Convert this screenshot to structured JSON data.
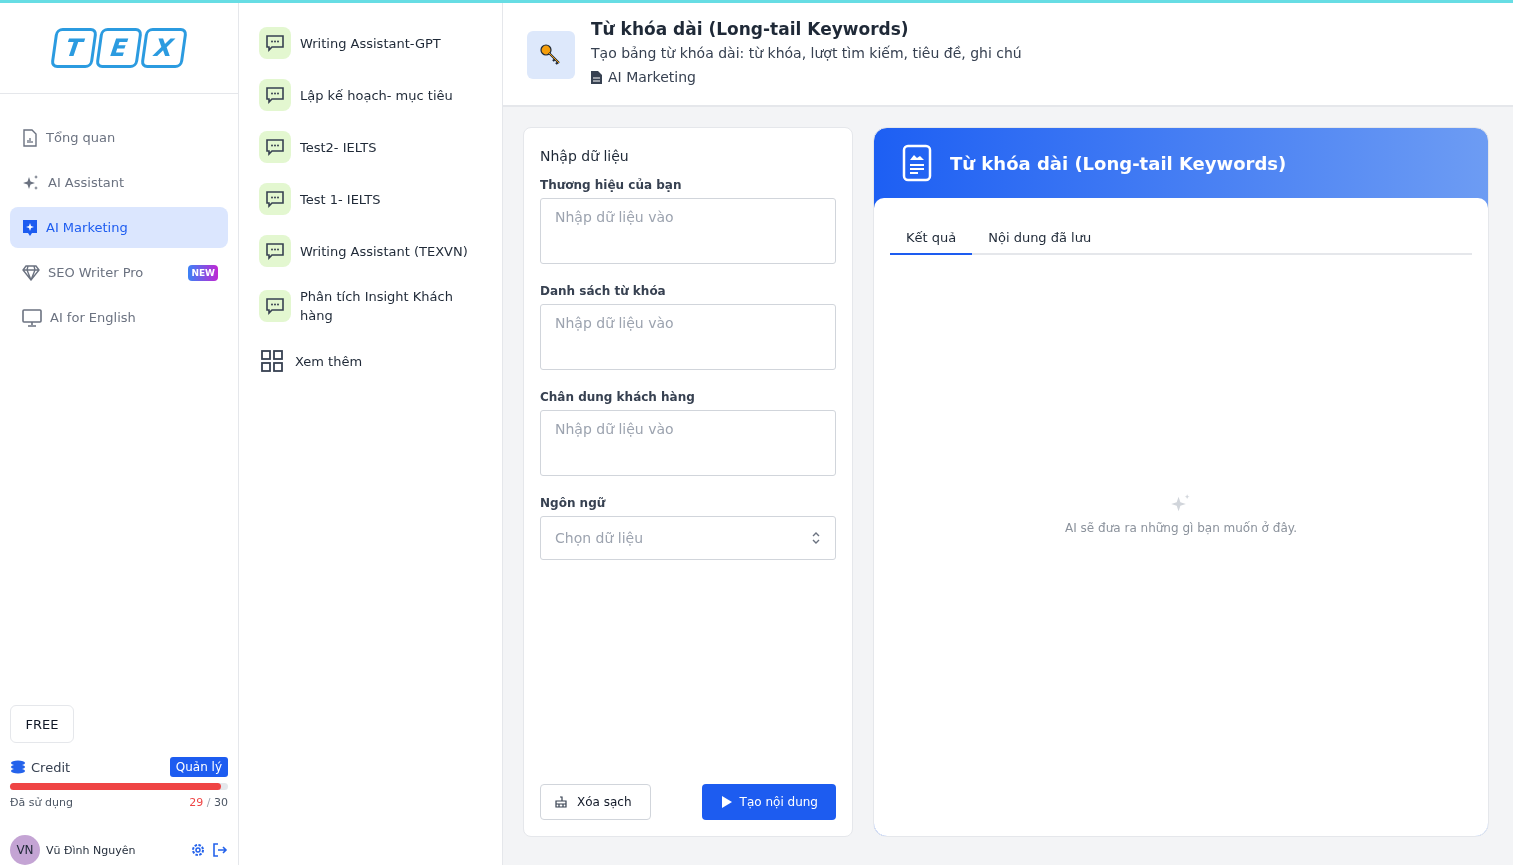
{
  "logo": {
    "letters": [
      "T",
      "E",
      "X"
    ]
  },
  "nav": [
    {
      "label": "Tổng quan",
      "kind": "overview",
      "selected": false
    },
    {
      "label": "AI Assistant",
      "kind": "assistant",
      "selected": false
    },
    {
      "label": "AI Marketing",
      "kind": "marketing",
      "selected": true
    },
    {
      "label": "SEO Writer Pro",
      "kind": "seo",
      "selected": false,
      "badge": "NEW"
    },
    {
      "label": "AI for English",
      "kind": "english",
      "selected": false
    }
  ],
  "plan": "FREE",
  "credit": {
    "label": "Credit",
    "manage": "Quản lý",
    "level": 0.97,
    "used_label": "Đã sử dụng",
    "used": "29",
    "separator": "/",
    "total": "30"
  },
  "user": {
    "initials": "VN",
    "name": "Vũ Đình Nguyên"
  },
  "assistants": [
    {
      "label": "Writing Assistant-GPT"
    },
    {
      "label": "Lập kế hoạch- mục tiêu"
    },
    {
      "label": "Test2- IELTS"
    },
    {
      "label": "Test 1- IELTS"
    },
    {
      "label": "Writing Assistant (TEXVN)"
    },
    {
      "label": "Phân tích Insight Khách hàng"
    }
  ],
  "more": "Xem thêm",
  "tool": {
    "title": "Từ khóa dài (Long-tail Keywords)",
    "description": "Tạo bảng từ khóa dài: từ khóa, lượt tìm kiếm, tiêu đề, ghi chú",
    "category": "AI Marketing"
  },
  "form": {
    "title": "Nhập dữ liệu",
    "fields": [
      {
        "kind": "textarea",
        "label": "Thương hiệu của bạn",
        "placeholder": "Nhập dữ liệu vào"
      },
      {
        "kind": "textarea",
        "label": "Danh sách từ khóa",
        "placeholder": "Nhập dữ liệu vào"
      },
      {
        "kind": "textarea",
        "label": "Chân dung khách hàng",
        "placeholder": "Nhập dữ liệu vào"
      },
      {
        "kind": "select",
        "label": "Ngôn ngữ",
        "placeholder": "Chọn dữ liệu"
      }
    ],
    "clear": "Xóa sạch",
    "generate": "Tạo nội dung"
  },
  "result": {
    "title": "Từ khóa dài (Long-tail Keywords)",
    "tabs": [
      {
        "label": "Kết quả",
        "selected": true
      },
      {
        "label": "Nội dung đã lưu",
        "selected": false
      }
    ],
    "empty": "AI sẽ đưa ra những gì bạn muốn ở đây."
  }
}
